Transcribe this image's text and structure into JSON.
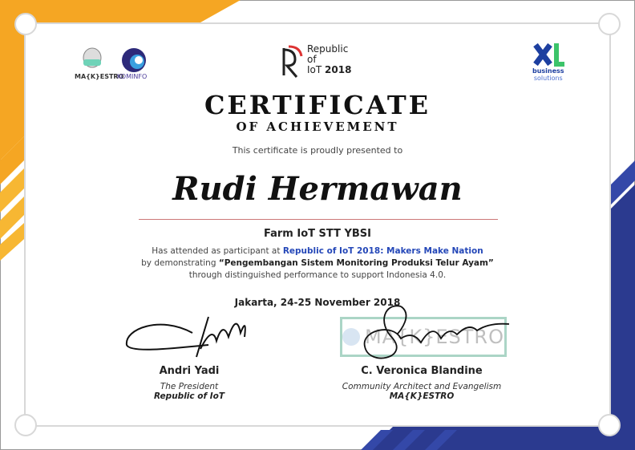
{
  "logos": {
    "makestro": "MA{K}ESTRO",
    "kominfo": "KOMINFO",
    "republic": [
      "Republic",
      "of",
      "IoT",
      "2018"
    ],
    "xl": [
      "business",
      "solutions"
    ]
  },
  "certificate": {
    "title": "CERTIFICATE",
    "subtitle": "OF ACHIEVEMENT",
    "presented": "This certificate is proudly presented to",
    "recipient": "Rudi Hermawan",
    "team": "Farm IoT STT YBSI",
    "line1_prefix": "Has attended as participant at ",
    "event": "Republic of IoT 2018: Makers Make Nation",
    "line2_prefix": "by demonstrating ",
    "project": "“Pengembangan Sistem Monitoring Produksi Telur Ayam”",
    "line3": "through distinguished performance to support Indonesia 4.0.",
    "date": "Jakarta, 24-25 November 2018"
  },
  "signatories": [
    {
      "name": "Andri Yadi",
      "role": "The President",
      "org": "Republic of IoT"
    },
    {
      "name": "C. Veronica Blandine",
      "role": "Community Architect and Evangelism",
      "org": "MA{K}ESTRO"
    }
  ],
  "stamp": "MA{K}ESTRO",
  "colors": {
    "orange": "#f5a623",
    "navy": "#2b3a8f",
    "link": "#2447b8"
  }
}
